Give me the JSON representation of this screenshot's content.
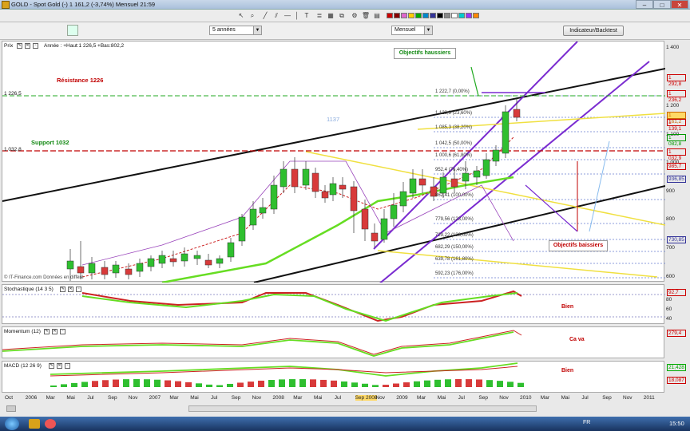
{
  "window": {
    "title": "GOLD - Spot Gold (-)   1 161,2 (-3,74%)   Mensuel  21:59",
    "min": "–",
    "max": "□",
    "close": "✕"
  },
  "controls": {
    "period": "5 années",
    "interval": "Mensuel",
    "indicator_button": "Indicateur/Backtest"
  },
  "price_panel": {
    "label": "Prix",
    "info": "Année : +Haut:1 226,5 +Bas:802,2",
    "resistance": "Résistance 1226",
    "support": "Support 1032",
    "objectifs_haussiers": "Objectifs haussiers",
    "objectifs_baissiers": "Objectifs baissiers",
    "level_1226": "1 226,5",
    "level_1032": "1 032,8",
    "label_1137": "1137",
    "credit": "© IT-Finance.com  Données en différé",
    "fib_levels": [
      "1 222,7 (0,00%)",
      "1 123,9 (23,60%)",
      "1 085,3 (38,20%)",
      "1 042,5 (50,00%)",
      "1 000,6 (61,80%)",
      "952,4 (76,40%)",
      "862,41 (100,00%)",
      "779,56 (123,00%)",
      "729,22 (138,00%)",
      "682,29 (150,00%)",
      "639,78 (161,80%)",
      "592,23 (176,00%)"
    ],
    "y_ticks": [
      "1 400",
      "1 200",
      "1 100",
      "1 000",
      "900",
      "800",
      "700",
      "600"
    ],
    "tags": [
      "1 292,8",
      "1 236,2",
      "1 161,2",
      "1 139,1",
      "1 082,8",
      "1 032,9",
      "985,7",
      "936,85",
      "730,85"
    ]
  },
  "stoch": {
    "label": "Stochastique (14 3 5)",
    "comment": "Bien",
    "ticks": [
      "80",
      "60",
      "40"
    ],
    "tag": "92,7"
  },
  "momentum": {
    "label": "Momentum (12)",
    "comment": "Ca va",
    "tag": "279,4"
  },
  "macd": {
    "label": "MACD (12 26 9)",
    "comment": "Bien",
    "tags": [
      "21,428",
      "18,087"
    ]
  },
  "x_axis": [
    "Oct",
    "2006",
    "Mar",
    "Mai",
    "Jul",
    "Sep",
    "Nov",
    "2007",
    "Mar",
    "Mai",
    "Jul",
    "Sep",
    "Nov",
    "2008",
    "Mar",
    "Mai",
    "Jul",
    "Sep 2008",
    "Nov",
    "2009",
    "Mar",
    "Mai",
    "Jul",
    "Sep",
    "Nov",
    "2010",
    "Mar",
    "Mai",
    "Jul",
    "Sep",
    "Nov",
    "2011"
  ],
  "taskbar": {
    "lang": "FR",
    "clock": "15:50"
  },
  "colors": {
    "up": "#2fbf2f",
    "down": "#d83a3a",
    "channel": "#7a2bd0",
    "trend": "#111111",
    "fib": "#6a7fd0",
    "resist": "#c00000",
    "support": "#118811"
  }
}
